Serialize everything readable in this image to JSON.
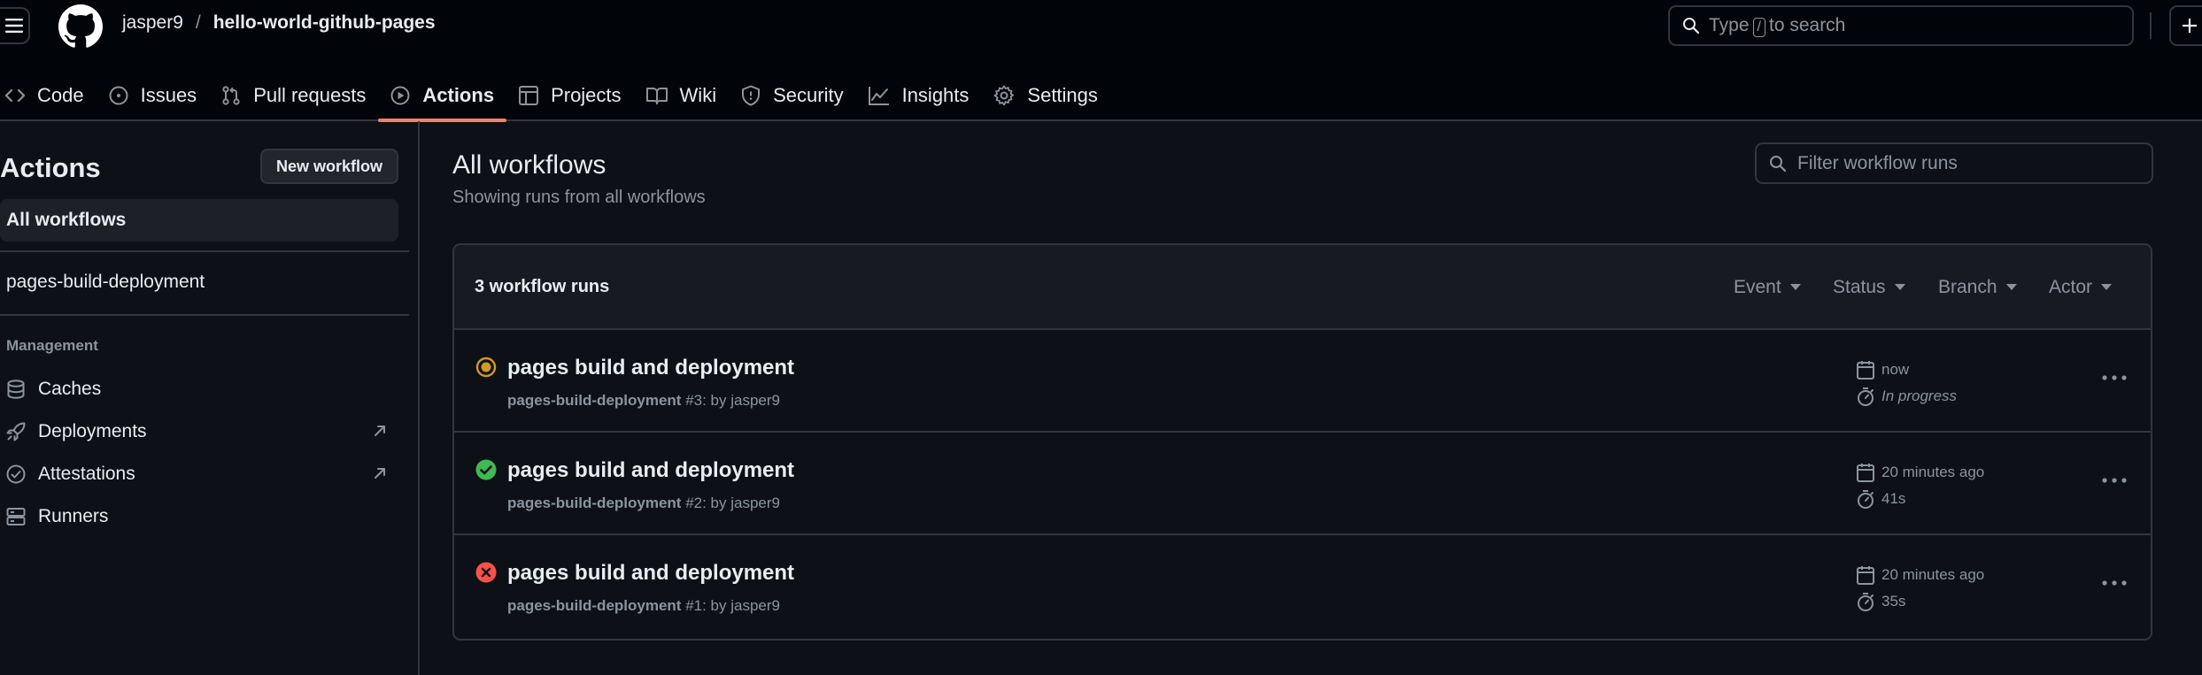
{
  "header": {
    "owner": "jasper9",
    "separator": "/",
    "repo": "hello-world-github-pages",
    "search": {
      "pre": "Type",
      "key": "/",
      "post": "to search"
    }
  },
  "tabs": [
    {
      "label": "Code",
      "icon": "code-icon",
      "active": false
    },
    {
      "label": "Issues",
      "icon": "issue-opened-icon",
      "active": false
    },
    {
      "label": "Pull requests",
      "icon": "git-pull-request-icon",
      "active": false
    },
    {
      "label": "Actions",
      "icon": "play-icon",
      "active": true
    },
    {
      "label": "Projects",
      "icon": "table-icon",
      "active": false
    },
    {
      "label": "Wiki",
      "icon": "book-icon",
      "active": false
    },
    {
      "label": "Security",
      "icon": "shield-icon",
      "active": false
    },
    {
      "label": "Insights",
      "icon": "graph-icon",
      "active": false
    },
    {
      "label": "Settings",
      "icon": "gear-icon",
      "active": false
    }
  ],
  "sidebar": {
    "title": "Actions",
    "new_workflow_label": "New workflow",
    "all_workflows_label": "All workflows",
    "workflow_item": "pages-build-deployment",
    "management_heading": "Management",
    "management_items": [
      {
        "label": "Caches",
        "icon": "database-icon",
        "external": false
      },
      {
        "label": "Deployments",
        "icon": "rocket-icon",
        "external": true
      },
      {
        "label": "Attestations",
        "icon": "check-circle-icon",
        "external": true
      },
      {
        "label": "Runners",
        "icon": "server-icon",
        "external": false
      }
    ]
  },
  "main": {
    "title": "All workflows",
    "subtitle": "Showing runs from all workflows",
    "filter_placeholder": "Filter workflow runs",
    "runs_count": "3 workflow runs",
    "filters": [
      "Event",
      "Status",
      "Branch",
      "Actor"
    ],
    "runs": [
      {
        "title": "pages build and deployment",
        "workflow": "pages-build-deployment",
        "run_ref": "#3: by jasper9",
        "time": "now",
        "duration": "In progress",
        "status": "in-progress"
      },
      {
        "title": "pages build and deployment",
        "workflow": "pages-build-deployment",
        "run_ref": "#2: by jasper9",
        "time": "20 minutes ago",
        "duration": "41s",
        "status": "success"
      },
      {
        "title": "pages build and deployment",
        "workflow": "pages-build-deployment",
        "run_ref": "#1: by jasper9",
        "time": "20 minutes ago",
        "duration": "35s",
        "status": "failure"
      }
    ]
  },
  "colors": {
    "background": "#0d1117",
    "header_bg": "#010409",
    "border": "#30363d",
    "muted": "#8b949e",
    "active_underline": "#f78166",
    "in_progress": "#d29922",
    "success": "#3fb950",
    "failure": "#f85149"
  }
}
